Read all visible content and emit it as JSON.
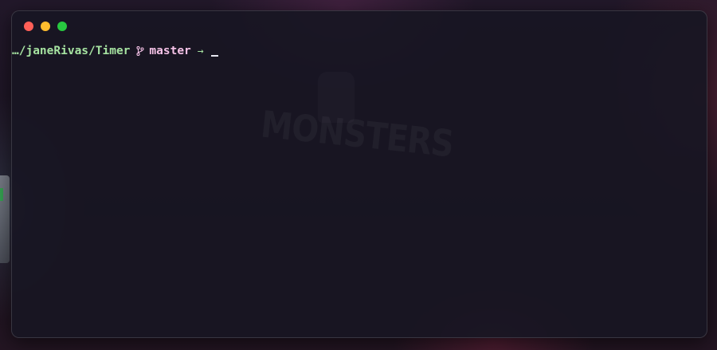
{
  "terminal": {
    "prompt": {
      "path": "…/janeRivas/Timer",
      "branch_icon": "git-branch-icon",
      "branch": "master",
      "arrow": "→"
    }
  },
  "colors": {
    "close": "#ff5f57",
    "minimize": "#febc2e",
    "zoom": "#28c840",
    "path": "#a6e3a1",
    "branch": "#f5c2e7",
    "window_bg": "#181622"
  }
}
